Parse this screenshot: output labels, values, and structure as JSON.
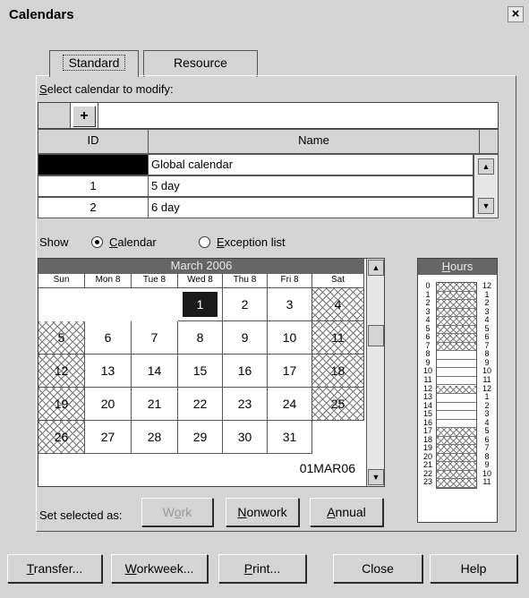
{
  "window": {
    "title": "Calendars",
    "close_glyph": "×"
  },
  "tabs": [
    {
      "label": "Standard",
      "active": true
    },
    {
      "label": "Resource",
      "active": false
    }
  ],
  "select_label": "Select calendar to modify:",
  "add_glyph": "+",
  "table": {
    "columns": [
      "ID",
      "Name"
    ],
    "rows": [
      {
        "id": "",
        "name": "Global calendar",
        "selected": true
      },
      {
        "id": "1",
        "name": "5 day"
      },
      {
        "id": "2",
        "name": "6 day"
      }
    ]
  },
  "show": {
    "label": "Show",
    "options": [
      "Calendar",
      "Exception list"
    ],
    "selected": "Calendar"
  },
  "calendar": {
    "month_title": "March 2006",
    "day_headers": [
      "Sun",
      "Mon  8",
      "Tue  8",
      "Wed  8",
      "Thu  8",
      "Fri  8",
      "Sat"
    ],
    "weeks": [
      [
        "",
        "",
        "",
        "1",
        "2",
        "3",
        "4"
      ],
      [
        "5",
        "6",
        "7",
        "8",
        "9",
        "10",
        "11"
      ],
      [
        "12",
        "13",
        "14",
        "15",
        "16",
        "17",
        "18"
      ],
      [
        "19",
        "20",
        "21",
        "22",
        "23",
        "24",
        "25"
      ],
      [
        "26",
        "27",
        "28",
        "29",
        "30",
        "31",
        ""
      ]
    ],
    "selected_day": "1",
    "date_code": "01MAR06"
  },
  "set_selected": {
    "label": "Set selected as:",
    "work": "Work",
    "nonwork": "Nonwork",
    "annual": "Annual"
  },
  "hours": {
    "title": "Hours",
    "left_labels": [
      "0",
      "1",
      "2",
      "3",
      "4",
      "5",
      "6",
      "7",
      "8",
      "9",
      "10",
      "11",
      "12",
      "13",
      "14",
      "15",
      "16",
      "17",
      "18",
      "19",
      "20",
      "21",
      "22",
      "23"
    ],
    "right_labels": [
      "12",
      "1",
      "2",
      "3",
      "4",
      "5",
      "6",
      "7",
      "8",
      "9",
      "10",
      "11",
      "12",
      "1",
      "2",
      "3",
      "4",
      "5",
      "6",
      "7",
      "8",
      "9",
      "10",
      "11"
    ],
    "nonwork_hours": [
      0,
      1,
      2,
      3,
      4,
      5,
      6,
      7,
      12,
      17,
      18,
      19,
      20,
      21,
      22,
      23
    ]
  },
  "bottom_buttons": {
    "transfer": "Transfer...",
    "workweek": "Workweek...",
    "print": "Print...",
    "close": "Close",
    "help": "Help"
  },
  "colors": {
    "window_bg": "#d4d4d4",
    "cal_header": "#666666",
    "selected_day": "#1a1a1a"
  }
}
